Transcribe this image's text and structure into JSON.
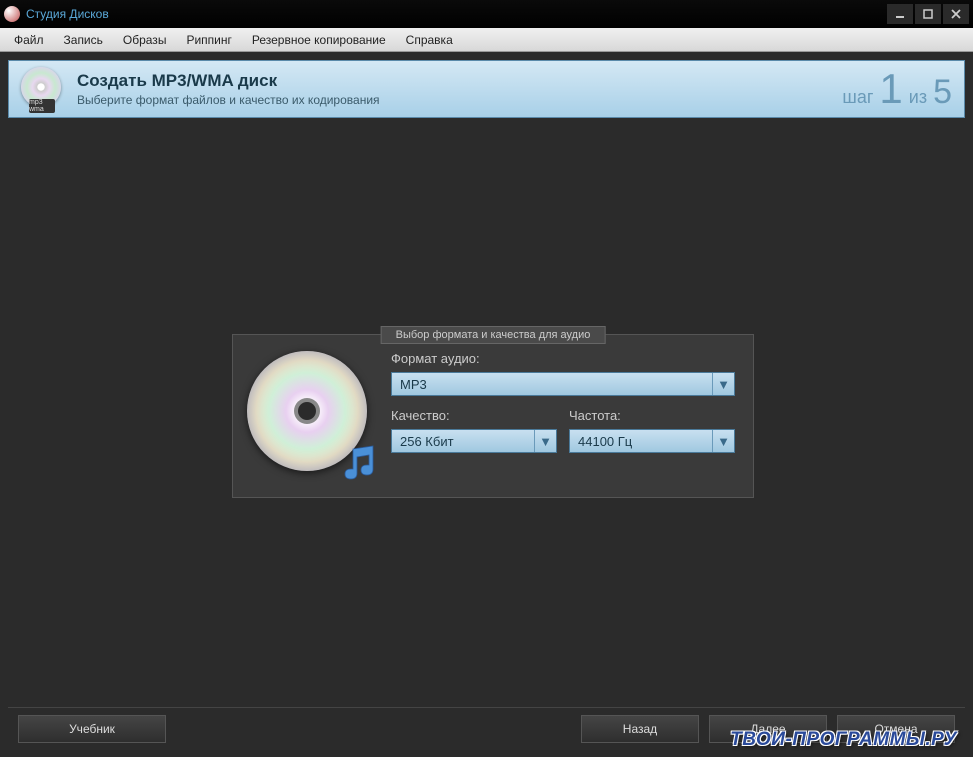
{
  "titlebar": {
    "title": "Студия Дисков"
  },
  "menubar": {
    "items": [
      "Файл",
      "Запись",
      "Образы",
      "Риппинг",
      "Резервное копирование",
      "Справка"
    ]
  },
  "header": {
    "title": "Создать MP3/WMA диск",
    "subtitle": "Выберите формат файлов и качество их кодирования",
    "icon_tag": "mp3 wma",
    "step_word": "шаг",
    "step_current": "1",
    "step_of": "из",
    "step_total": "5"
  },
  "panel": {
    "legend": "Выбор формата и качества для аудио",
    "format_label": "Формат аудио:",
    "format_value": "MP3",
    "quality_label": "Качество:",
    "quality_value": "256 Кбит",
    "freq_label": "Частота:",
    "freq_value": "44100 Гц"
  },
  "footer": {
    "tutorial": "Учебник",
    "back": "Назад",
    "next": "Далее",
    "cancel": "Отмена"
  },
  "watermark": "ТВОИ-ПРОГРАММЫ.РУ"
}
